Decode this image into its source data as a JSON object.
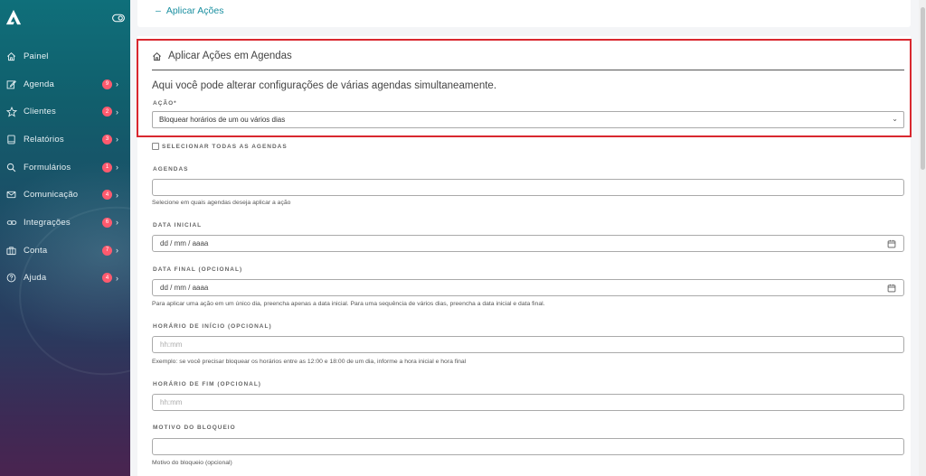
{
  "sidebar": {
    "items": [
      {
        "label": "Painel",
        "icon": "home-icon",
        "badge": null
      },
      {
        "label": "Agenda",
        "icon": "edit-icon",
        "badge": "9"
      },
      {
        "label": "Clientes",
        "icon": "star-icon",
        "badge": "2"
      },
      {
        "label": "Relatórios",
        "icon": "book-icon",
        "badge": "3"
      },
      {
        "label": "Formulários",
        "icon": "search-icon",
        "badge": "1"
      },
      {
        "label": "Comunicação",
        "icon": "mail-icon",
        "badge": "4"
      },
      {
        "label": "Integrações",
        "icon": "link-icon",
        "badge": "6"
      },
      {
        "label": "Conta",
        "icon": "briefcase-icon",
        "badge": "7"
      },
      {
        "label": "Ajuda",
        "icon": "help-icon",
        "badge": "4"
      }
    ]
  },
  "top": {
    "collapse_label": "Aplicar Ações"
  },
  "card": {
    "title": "Aplicar Ações em Agendas",
    "intro": "Aqui você pode alterar configurações de várias agendas simultaneamente.",
    "acao_label": "AÇÃO*",
    "acao_value": "Bloquear horários de um ou vários dias",
    "select_all_label": "SELECIONAR TODAS AS AGENDAS",
    "agendas_label": "AGENDAS",
    "agendas_help": "Selecione em quais agendas deseja aplicar a ação",
    "data_inicial_label": "DATA INICIAL",
    "date_placeholder": "dd / mm / aaaa",
    "data_final_label": "DATA FINAL (OPCIONAL)",
    "data_help": "Para aplicar uma ação em um único dia, preencha apenas a data inicial. Para uma sequência de vários dias, preencha a data inicial e data final.",
    "hora_inicio_label": "HORÁRIO DE INÍCIO (OPCIONAL)",
    "time_placeholder": "hh:mm",
    "hora_help": "Exemplo: se você precisar bloquear os horários entre as 12:00 e 18:00 de um dia, informe a hora inicial e hora final",
    "hora_fim_label": "HORÁRIO DE FIM (OPCIONAL)",
    "motivo_label": "MOTIVO DO BLOQUEIO",
    "motivo_help": "Motivo do bloqueio (opcional)"
  },
  "colors": {
    "accent": "#1a8fa0",
    "badge": "#ff5a6e",
    "highlight": "#d9282f"
  }
}
